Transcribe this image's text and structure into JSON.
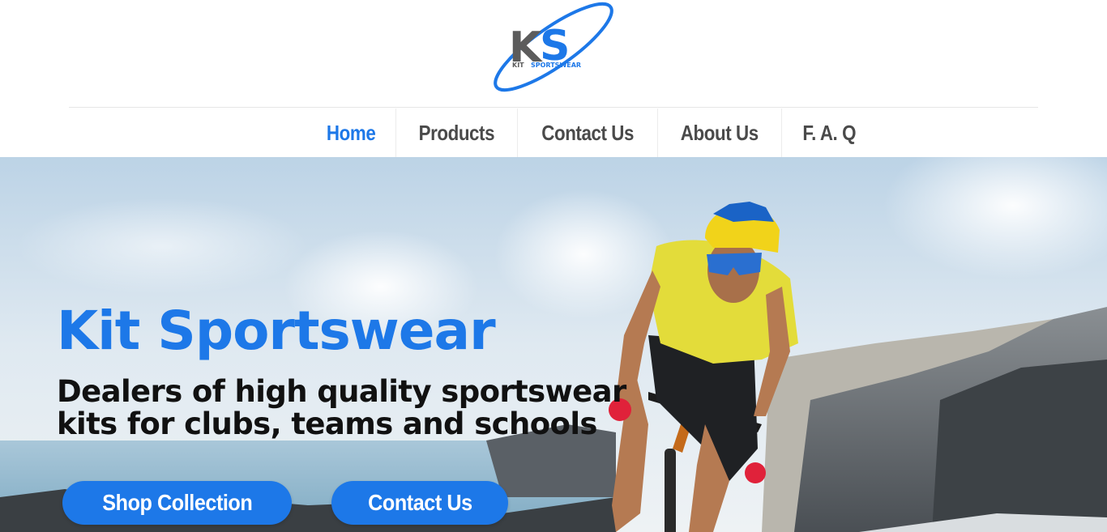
{
  "logo": {
    "monogram": "KS",
    "brand_left": "KIT",
    "brand_right": "SPORTSWEAR"
  },
  "nav": {
    "items": [
      {
        "label": "Home",
        "active": true
      },
      {
        "label": "Products",
        "active": false
      },
      {
        "label": "Contact Us",
        "active": false
      },
      {
        "label": "About Us",
        "active": false
      },
      {
        "label": "F. A. Q",
        "active": false
      }
    ]
  },
  "hero": {
    "title": "Kit Sportswear",
    "subtitle_line1": "Dealers of high quality sportswear",
    "subtitle_line2": "kits for clubs, teams and schools",
    "primary_button": "Shop Collection",
    "secondary_button": "Contact Us"
  },
  "colors": {
    "accent": "#1d78e8",
    "nav_text": "#4a4a4a",
    "heading_dark": "#111111"
  }
}
